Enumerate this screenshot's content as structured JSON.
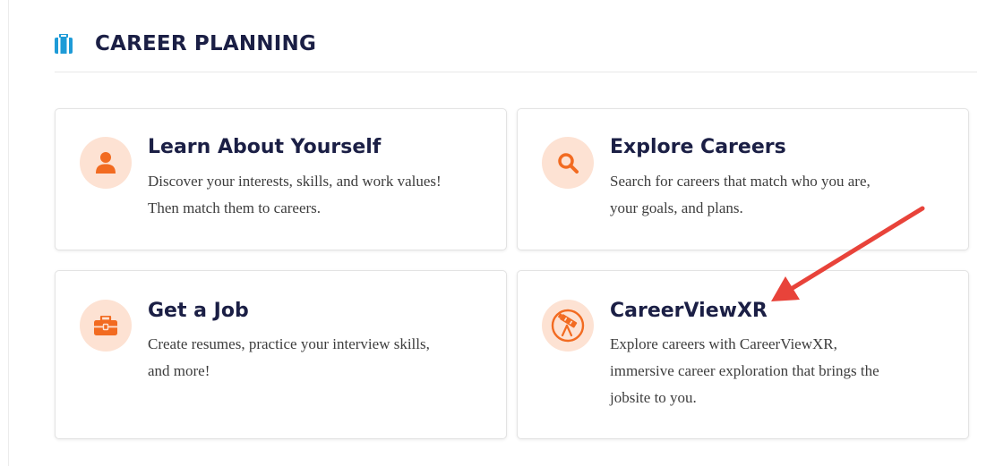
{
  "section": {
    "title": "CAREER PLANNING",
    "icon": "briefcase-icon"
  },
  "cards": [
    {
      "title": "Learn About Yourself",
      "description_line1": "Discover your interests, skills, and work values!",
      "description_line2": "Then match them to careers.",
      "icon": "person-icon"
    },
    {
      "title": "Explore Careers",
      "description_line1": "Search for careers that match who you are,",
      "description_line2": "your goals, and plans.",
      "icon": "search-icon"
    },
    {
      "title": "Get a Job",
      "description_line1": "Create resumes, practice your interview skills,",
      "description_line2": "and more!",
      "icon": "toolbox-icon"
    },
    {
      "title": "CareerViewXR",
      "description_line1": "Explore careers with CareerViewXR,",
      "description_line2": "immersive career exploration that brings the",
      "description_line3": "jobsite to you.",
      "icon": "telescope-icon"
    }
  ],
  "colors": {
    "accent": "#f26b21",
    "icon_bg": "#fde2d3",
    "heading": "#1b1f45",
    "section_icon": "#1e9bd7",
    "annotation_arrow": "#e8433a"
  }
}
